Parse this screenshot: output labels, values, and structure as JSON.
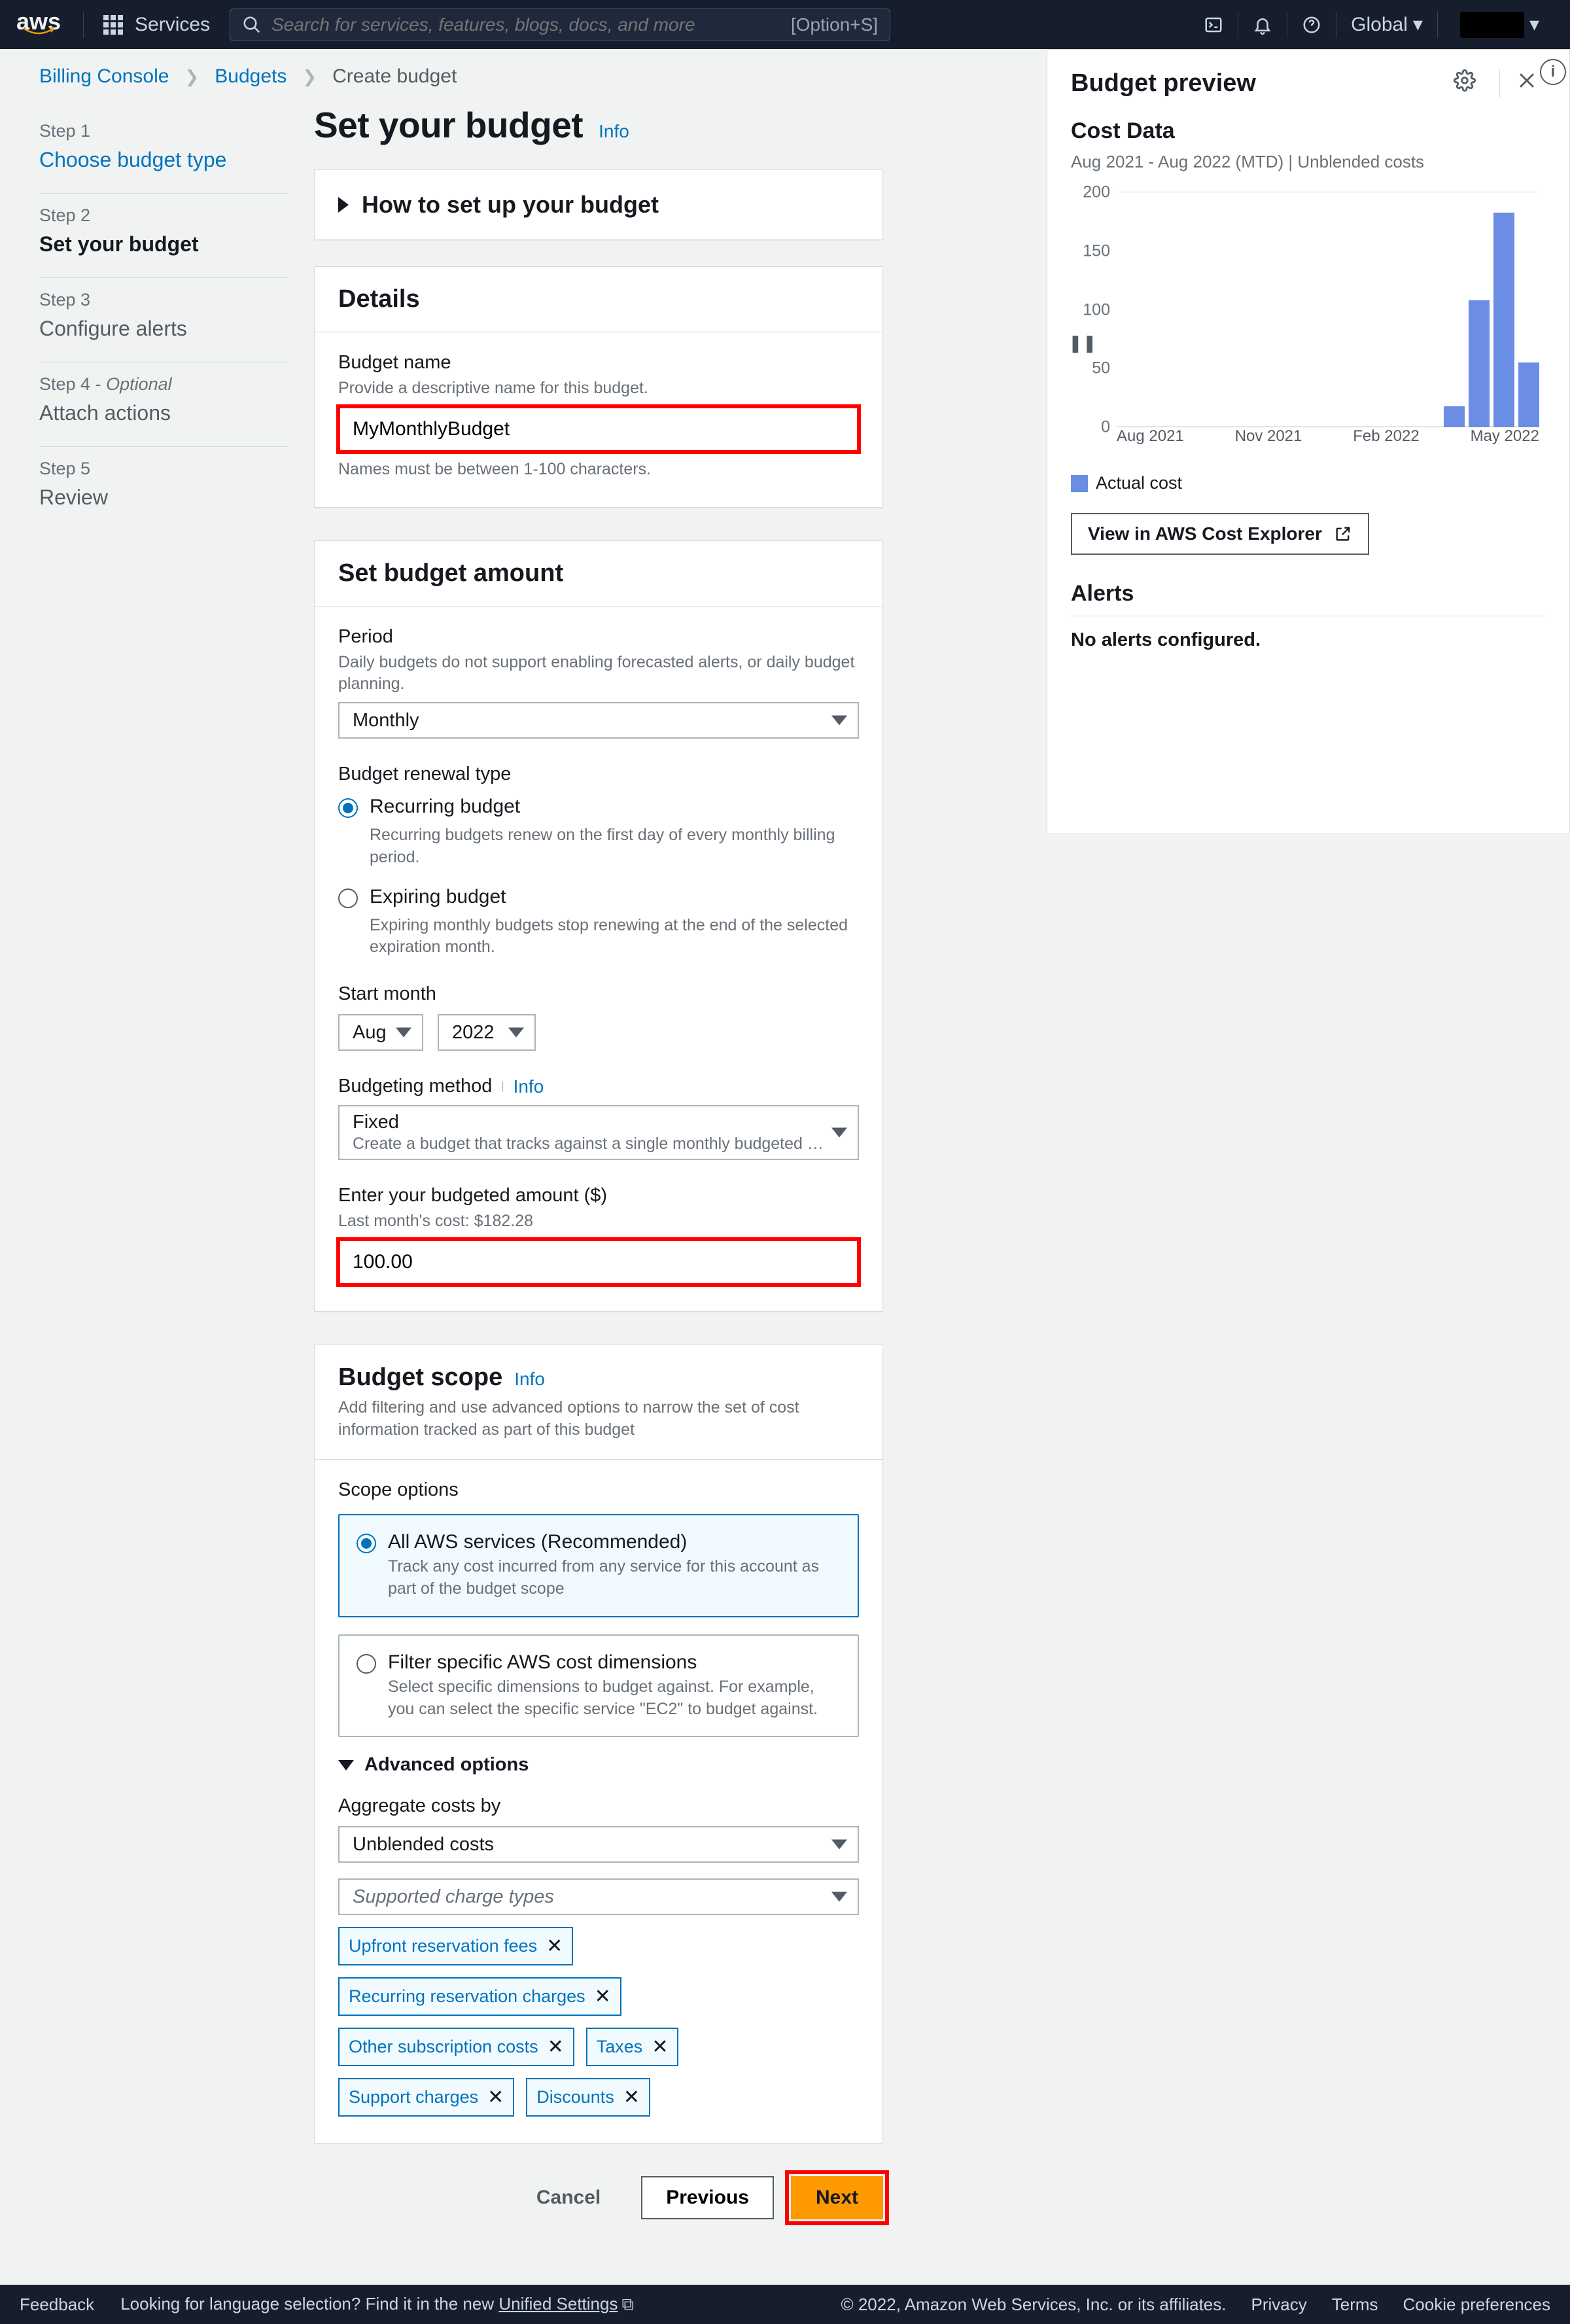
{
  "nav": {
    "logo": "aws",
    "services": "Services",
    "search_placeholder": "Search for services, features, blogs, docs, and more",
    "search_kbd": "[Option+S]",
    "region": "Global"
  },
  "breadcrumbs": {
    "a": "Billing Console",
    "b": "Budgets",
    "c": "Create budget"
  },
  "steps": [
    {
      "label": "Step 1",
      "title": "Choose budget type"
    },
    {
      "label": "Step 2",
      "title": "Set your budget"
    },
    {
      "label": "Step 3",
      "title": "Configure alerts"
    },
    {
      "label": "Step 4 - ",
      "opt": "Optional",
      "title": "Attach actions"
    },
    {
      "label": "Step 5",
      "title": "Review"
    }
  ],
  "page": {
    "title": "Set your budget",
    "info": "Info"
  },
  "howto": "How to set up your budget",
  "details": {
    "header": "Details",
    "name_label": "Budget name",
    "name_help": "Provide a descriptive name for this budget.",
    "name_value": "MyMonthlyBudget",
    "name_below": "Names must be between 1-100 characters."
  },
  "amount": {
    "header": "Set budget amount",
    "period_label": "Period",
    "period_help": "Daily budgets do not support enabling forecasted alerts, or daily budget planning.",
    "period_value": "Monthly",
    "renewal_label": "Budget renewal type",
    "recurring": "Recurring budget",
    "recurring_desc": "Recurring budgets renew on the first day of every monthly billing period.",
    "expiring": "Expiring budget",
    "expiring_desc": "Expiring monthly budgets stop renewing at the end of the selected expiration month.",
    "start_label": "Start month",
    "start_m": "Aug",
    "start_y": "2022",
    "method_label": "Budgeting method",
    "method_info": "Info",
    "method_value": "Fixed",
    "method_sub": "Create a budget that tracks against a single monthly budgeted a...",
    "amt_label": "Enter your budgeted amount ($)",
    "amt_help": "Last month's cost: $182.28",
    "amt_value": "100.00"
  },
  "scope": {
    "header": "Budget scope",
    "info": "Info",
    "desc": "Add filtering and use advanced options to narrow the set of cost information tracked as part of this budget",
    "options_label": "Scope options",
    "all": "All AWS services (Recommended)",
    "all_desc": "Track any cost incurred from any service for this account as part of the budget scope",
    "filter": "Filter specific AWS cost dimensions",
    "filter_desc": "Select specific dimensions to budget against. For example, you can select the specific service \"EC2\" to budget against.",
    "adv": "Advanced options",
    "agg_label": "Aggregate costs by",
    "agg_value": "Unblended costs",
    "charge_placeholder": "Supported charge types",
    "tokens": [
      "Upfront reservation fees",
      "Recurring reservation charges",
      "Other subscription costs",
      "Taxes",
      "Support charges",
      "Discounts"
    ]
  },
  "buttons": {
    "cancel": "Cancel",
    "prev": "Previous",
    "next": "Next"
  },
  "preview": {
    "title": "Budget preview",
    "cost_data": "Cost Data",
    "range": "Aug 2021 - Aug 2022 (MTD) | Unblended costs",
    "legend": "Actual cost",
    "view_btn": "View in AWS Cost Explorer",
    "alerts": "Alerts",
    "no_alerts": "No alerts configured."
  },
  "chart_data": {
    "type": "bar",
    "title": "",
    "xlabel": "",
    "ylabel": "",
    "ylim": [
      0,
      200
    ],
    "y_ticks": [
      "200",
      "150",
      "100",
      "50",
      "0"
    ],
    "x_ticks": [
      "Aug 2021",
      "Nov 2021",
      "Feb 2022",
      "May 2022"
    ],
    "categories": [
      "Aug 2021",
      "Sep 2021",
      "Oct 2021",
      "Nov 2021",
      "Dec 2021",
      "Jan 2022",
      "Feb 2022",
      "Mar 2022",
      "Apr 2022",
      "May 2022",
      "Jun 2022",
      "Jul 2022",
      "Aug 2022"
    ],
    "series": [
      {
        "name": "Actual cost",
        "values": [
          0,
          0,
          0,
          0,
          0,
          0,
          0,
          0,
          0,
          18,
          108,
          182,
          55
        ]
      }
    ]
  },
  "footer": {
    "feedback": "Feedback",
    "lang": "Looking for language selection? Find it in the new",
    "unified": "Unified Settings",
    "copyright": "© 2022, Amazon Web Services, Inc. or its affiliates.",
    "privacy": "Privacy",
    "terms": "Terms",
    "cookies": "Cookie preferences"
  }
}
